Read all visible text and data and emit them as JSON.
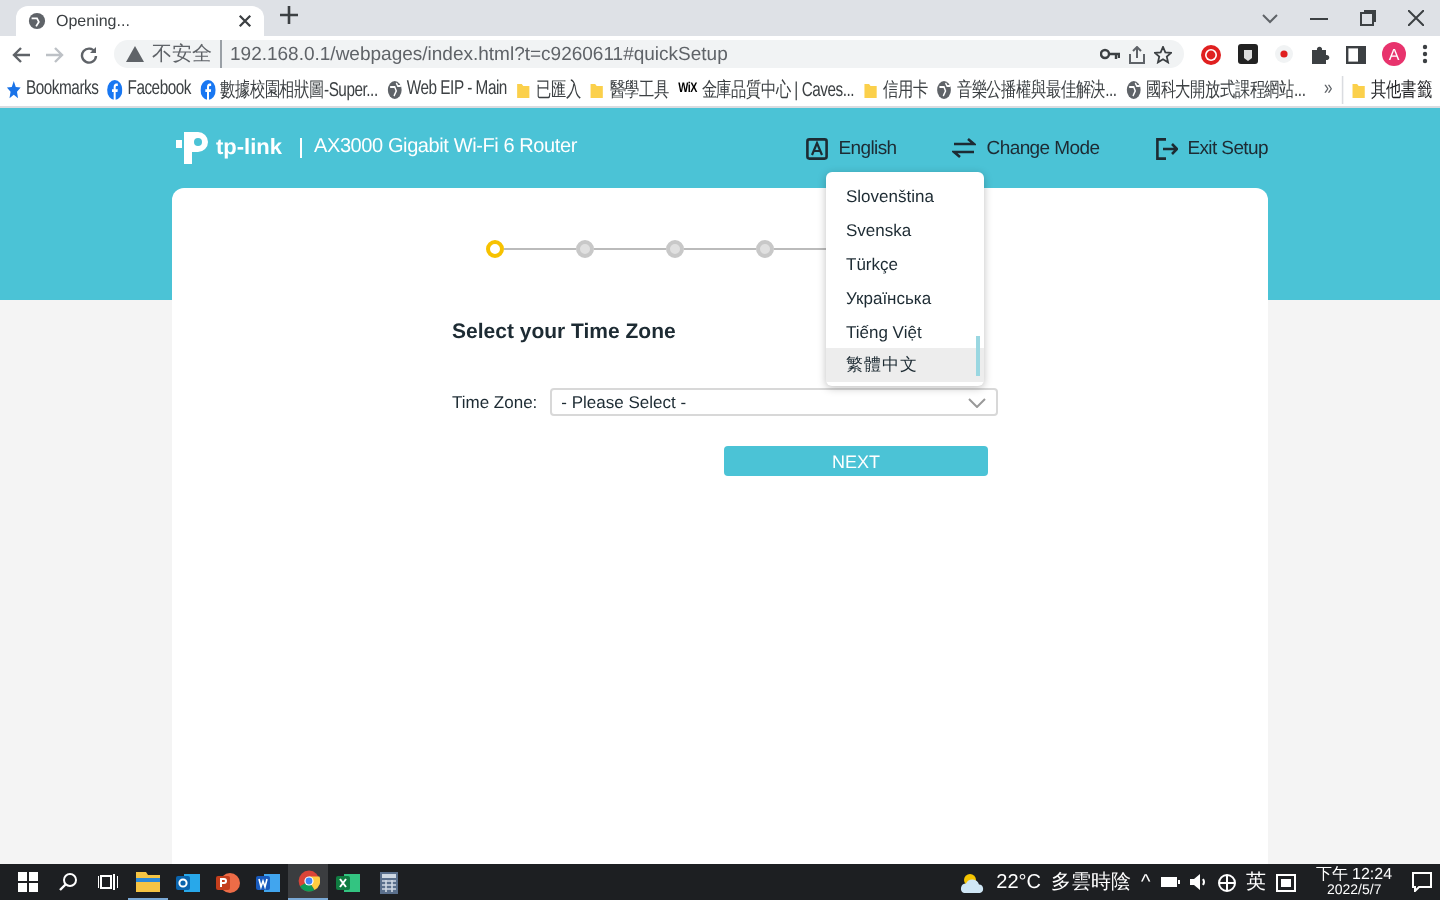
{
  "browser": {
    "tab": {
      "title": "Opening..."
    },
    "address": {
      "security": "不安全",
      "url": "192.168.0.1/webpages/index.html?t=c9260611#quickSetup"
    },
    "profile": {
      "initial": "A"
    },
    "bookmarks": [
      {
        "label": "Bookmarks",
        "kind": "star"
      },
      {
        "label": "Facebook",
        "kind": "facebook"
      },
      {
        "label": "數據校園相狀圖-Super...",
        "kind": "facebook"
      },
      {
        "label": "Web EIP - Main",
        "kind": "globe"
      },
      {
        "label": "已匯入",
        "kind": "folder"
      },
      {
        "label": "醫學工具",
        "kind": "folder"
      },
      {
        "label": "金庫品質中心 | Caves...",
        "kind": "wix",
        "mark": "WiX"
      },
      {
        "label": "信用卡",
        "kind": "folder"
      },
      {
        "label": "音樂公播權與最佳解決...",
        "kind": "globe"
      },
      {
        "label": "國科大開放式課程網站...",
        "kind": "globe"
      }
    ],
    "more": "»",
    "other_bookmarks": "其他書籤"
  },
  "router": {
    "brand": "tp-link",
    "product": "AX3000 Gigabit Wi-Fi 6 Router",
    "nav": [
      {
        "label": "English",
        "kind": "language"
      },
      {
        "label": "Change Mode",
        "kind": "mode"
      },
      {
        "label": "Exit Setup",
        "kind": "exit"
      }
    ],
    "steps": [
      {
        "selected": true
      },
      {
        "selected": false
      },
      {
        "selected": false
      },
      {
        "selected": false
      }
    ],
    "heading": "Select your Time Zone",
    "field": {
      "label": "Time Zone:",
      "value": "- Please Select -"
    },
    "button": "NEXT",
    "language_menu": [
      {
        "label": "Slovenština",
        "selected": false
      },
      {
        "label": "Svenska",
        "selected": false
      },
      {
        "label": "Türkçe",
        "selected": false
      },
      {
        "label": "Українська",
        "selected": false
      },
      {
        "label": "Tiếng Việt",
        "selected": false
      },
      {
        "label": "繁體中文",
        "selected": true
      }
    ]
  },
  "taskbar": {
    "apps": [
      {
        "kind": "start",
        "running": false,
        "selected": false
      },
      {
        "kind": "search",
        "running": false,
        "selected": false
      },
      {
        "kind": "taskview",
        "running": false,
        "selected": false
      },
      {
        "kind": "explorer",
        "running": true,
        "selected": false
      },
      {
        "kind": "outlook",
        "running": false,
        "selected": false
      },
      {
        "kind": "powerpoint",
        "running": false,
        "selected": false
      },
      {
        "kind": "word",
        "running": false,
        "selected": false
      },
      {
        "kind": "chrome",
        "running": true,
        "selected": true
      },
      {
        "kind": "excel",
        "running": false,
        "selected": false
      },
      {
        "kind": "calculator",
        "running": false,
        "selected": false
      }
    ],
    "weather": {
      "temperature": "22°C",
      "condition": "多雲時陰"
    },
    "tray_chevron": "^",
    "input_method": "英",
    "time": "下午 12:24",
    "date": "2022/5/7"
  }
}
